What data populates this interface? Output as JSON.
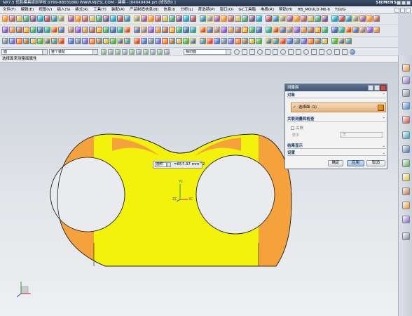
{
  "window": {
    "title": "NX7.5  优胜模具培训学校   0769-88031860   WWW.MJZSL.COM - 建模 - [04040404.prt  (修改的) ]",
    "brand": "SIEMENS"
  },
  "menubar": {
    "items": [
      "文件(F)",
      "编辑(E)",
      "视图(V)",
      "插入(S)",
      "格式(R)",
      "工具(T)",
      "装配(A)",
      "产品制造信息(N)",
      "信息(I)",
      "分析(L)",
      "首选项(P)",
      "窗口(O)",
      "GC工具箱",
      "电极(R)",
      "帮助(H)",
      "HB_MOULD M6.6",
      "YSUG"
    ]
  },
  "options_bar": {
    "filter_value": "面",
    "assembly_value": "整个装配",
    "snap_value": "相切面"
  },
  "cue_line": "选择面来测量面属性",
  "graphics": {
    "area_unit": "面积",
    "area_value": "=857.37 mm^2",
    "axis_labels": {
      "x": "XC",
      "y": "YC",
      "z": "ZC"
    },
    "colors": {
      "part_orange": "#f5a23c",
      "selected_yellow": "#f2f20a",
      "hole_fill": "#e9ebee",
      "outline": "#1a1a1a"
    }
  },
  "dialog": {
    "title": "测量面",
    "section_objects": "对象",
    "select_face_label": "选择面 (1)",
    "section_assoc": "关联测量和检查",
    "assoc_checkbox_label": "关联",
    "requirement_label": "要求",
    "requirement_value": "无",
    "section_results": "结果显示",
    "section_settings": "设置",
    "ok": "确定",
    "apply": "应用",
    "cancel": "取消"
  }
}
